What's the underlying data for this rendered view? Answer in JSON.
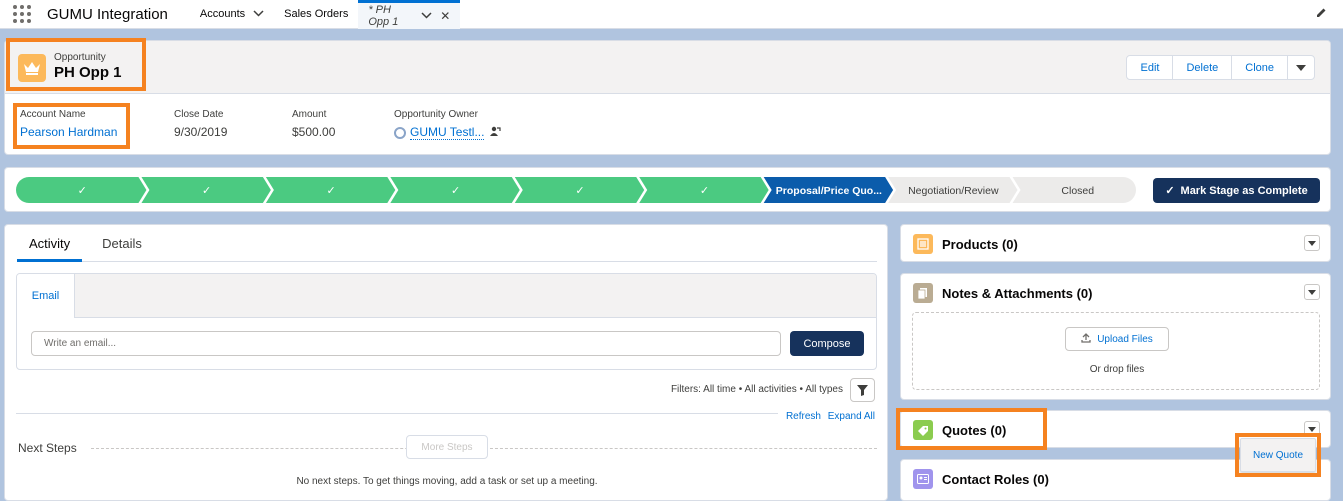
{
  "topnav": {
    "app_name": "GUMU Integration",
    "tabs": [
      {
        "label": "Accounts",
        "has_chevron": true
      },
      {
        "label": "Sales Orders",
        "has_chevron": false
      },
      {
        "label": "* PH Opp 1",
        "active": true
      }
    ]
  },
  "record": {
    "object_type": "Opportunity",
    "name": "PH Opp 1",
    "actions": [
      "Edit",
      "Delete",
      "Clone"
    ],
    "fields": [
      {
        "label": "Account Name",
        "value": "Pearson Hardman",
        "link": true
      },
      {
        "label": "Close Date",
        "value": "9/30/2019"
      },
      {
        "label": "Amount",
        "value": "$500.00"
      },
      {
        "label": "Opportunity Owner",
        "value": "GUMU Testl...",
        "link": true
      }
    ]
  },
  "path": {
    "completed_steps": 6,
    "current_stage": "Proposal/Price Quo...",
    "upcoming_stages": [
      "Negotiation/Review",
      "Closed"
    ],
    "mark_complete_label": "Mark Stage as Complete"
  },
  "activity": {
    "tabs": [
      "Activity",
      "Details"
    ],
    "publisher_tab": "Email",
    "email_placeholder": "Write an email...",
    "compose_label": "Compose",
    "filters_text": "Filters: All time • All activities • All types",
    "refresh_label": "Refresh",
    "expand_all_label": "Expand All",
    "next_steps_label": "Next Steps",
    "more_steps_label": "More Steps",
    "no_steps_text": "No next steps. To get things moving, add a task or set up a meeting."
  },
  "related": {
    "products_title": "Products (0)",
    "notes_title": "Notes & Attachments (0)",
    "upload_label": "Upload Files",
    "drop_text": "Or drop files",
    "quotes_title": "Quotes (0)",
    "new_quote_label": "New Quote",
    "contact_roles_title": "Contact Roles (0)"
  },
  "colors": {
    "brand_blue": "#0070d2",
    "navy_button": "#16325c",
    "complete_green": "#4bca81",
    "current_stage": "#0b5cab",
    "highlight_orange": "#f58220",
    "products_icon": "#fcb95b",
    "notes_icon": "#baac93",
    "quotes_icon": "#8bcc4f",
    "contact_icon": "#a094ed"
  }
}
